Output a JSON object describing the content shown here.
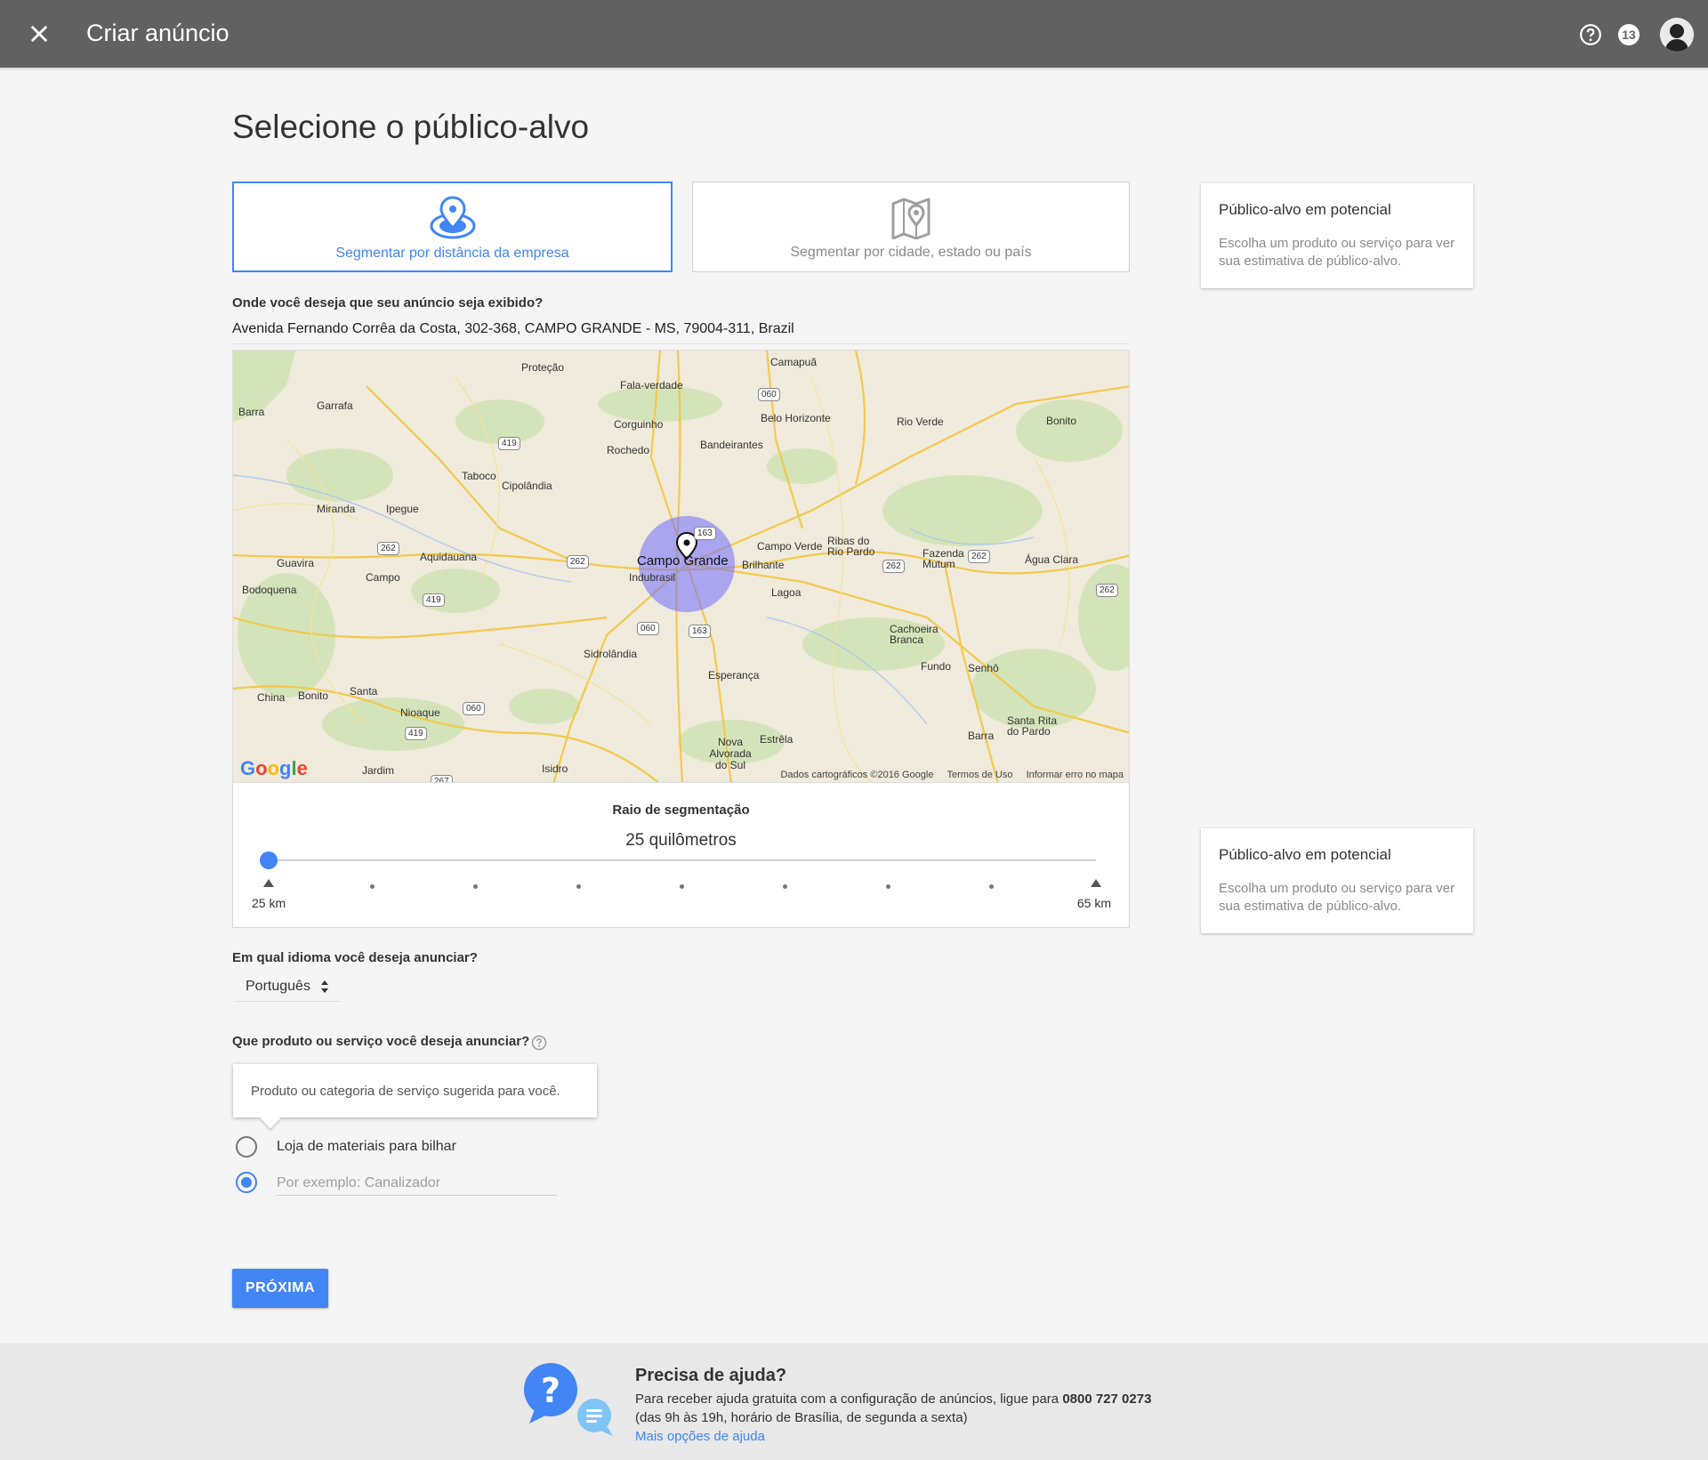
{
  "header": {
    "title": "Criar anúncio",
    "notification_count": "13",
    "icons": {
      "close": "close-icon",
      "help": "help-icon",
      "avatar": "avatar"
    }
  },
  "page": {
    "title": "Selecione o público-alvo"
  },
  "targeting_options": [
    {
      "label": "Segmentar por distância da empresa",
      "icon": "location-radius-icon",
      "selected": true
    },
    {
      "label": "Segmentar por cidade, estado ou país",
      "icon": "map-pin-icon",
      "selected": false
    }
  ],
  "potential_audience": {
    "title": "Público-alvo em potencial",
    "description": "Escolha um produto ou serviço para ver sua estimativa de público-alvo."
  },
  "location": {
    "question": "Onde você deseja que seu anúncio seja exibido?",
    "address": "Avenida Fernando Corrêa da Costa, 302-368, CAMPO GRANDE - MS, 79004-311, Brazil"
  },
  "map": {
    "center_label": "Campo Grande",
    "places": [
      "Proteção",
      "Camapuã",
      "Fala-verdade",
      "Barra",
      "Garrafa",
      "Corguinho",
      "Belo Horizonte",
      "Rio Verde",
      "Bonito",
      "Rochedo",
      "Bandeirantes",
      "Taboco",
      "Cipolândia",
      "Miranda",
      "Ipegue",
      "Campo Verde",
      "Ribas do Rio Pardo",
      "Fazenda Mutum",
      "Água Clara",
      "Guavira",
      "Aquidauana",
      "Brilhante",
      "Indubrasil",
      "Bodoquena",
      "Campo",
      "Lagoa",
      "Cachoeira Branca",
      "Sidrolândia",
      "Fundo",
      "Senhô",
      "Esperança",
      "China",
      "Bonito",
      "Santa",
      "Nioaque",
      "Santa Rita do Pardo",
      "Barra",
      "Estrêla",
      "Nova Alvorada do Sul",
      "Jardim",
      "Isidro"
    ],
    "roads": [
      "060",
      "419",
      "262",
      "262",
      "163",
      "262",
      "262",
      "262",
      "419",
      "060",
      "163",
      "060",
      "419",
      "267"
    ],
    "attribution": "Dados cartográficos ©2016 Google",
    "terms": "Termos de Uso",
    "report": "Informar erro no mapa",
    "logo": "Google"
  },
  "radius": {
    "label": "Raio de segmentação",
    "value_text": "25 quilômetros",
    "min_label": "25 km",
    "max_label": "65 km",
    "min_km": 25,
    "max_km": 65,
    "current_km": 25,
    "accent": "#4285f4"
  },
  "language": {
    "question": "Em qual idioma você deseja anunciar?",
    "selected": "Português"
  },
  "product": {
    "question": "Que produto ou serviço você deseja anunciar?",
    "tooltip": "Produto ou categoria de serviço sugerida para você.",
    "option_label": "Loja de materiais para bilhar",
    "example_placeholder": "Por exemplo: Canalizador"
  },
  "next_button": "PRÓXIMA",
  "help": {
    "title": "Precisa de ajuda?",
    "line1": "Para receber ajuda gratuita com a configuração de anúncios, ligue para",
    "phone": "0800 727 0273",
    "line2": "(das 9h às 19h, horário de Brasília, de segunda a sexta)",
    "link": "Mais opções de ajuda"
  }
}
